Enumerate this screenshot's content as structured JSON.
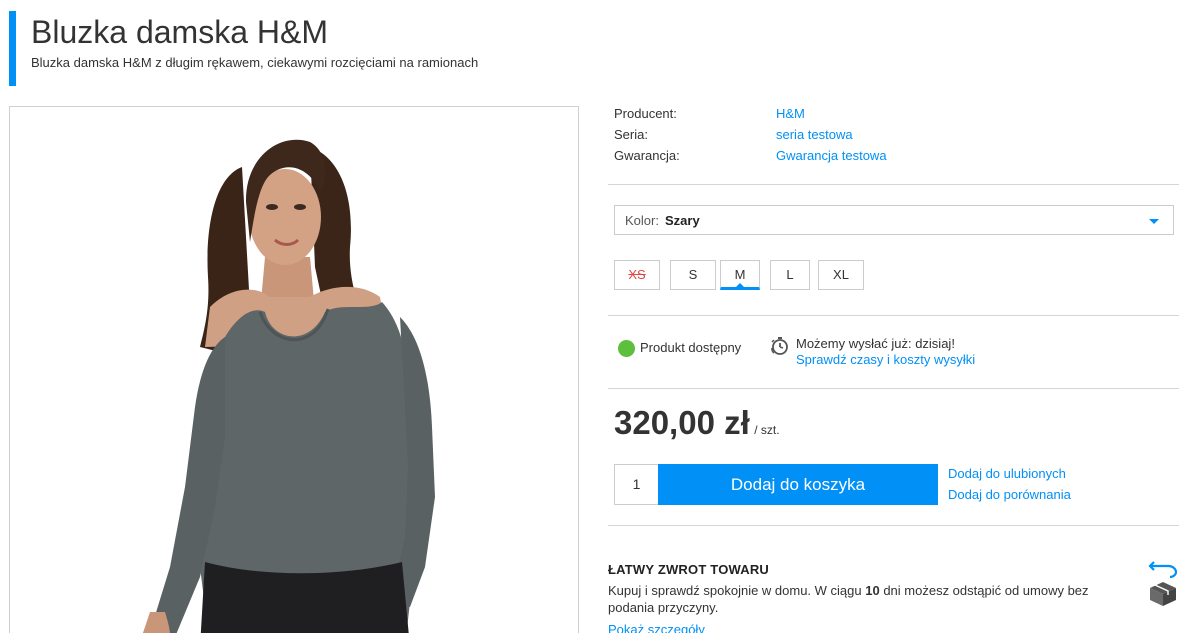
{
  "product": {
    "title": "Bluzka damska H&M",
    "subtitle": "Bluzka damska H&M z długim rękawem, ciekawymi rozcięciami na ramionach"
  },
  "image": {
    "alt": "model wearing grey blouse"
  },
  "specs": [
    {
      "key": "Producent:",
      "value": "H&M"
    },
    {
      "key": "Seria:",
      "value": "seria testowa"
    },
    {
      "key": "Gwarancja:",
      "value": "Gwarancja testowa"
    }
  ],
  "color": {
    "label": "Kolor:",
    "value": "Szary"
  },
  "sizes": [
    {
      "label": "XS",
      "state": "unavailable"
    },
    {
      "label": "S",
      "state": "available"
    },
    {
      "label": "M",
      "state": "selected"
    },
    {
      "label": "L",
      "state": "available"
    },
    {
      "label": "XL",
      "state": "available"
    }
  ],
  "availability": {
    "text": "Produkt dostępny",
    "shipping_line": "Możemy wysłać już:  dzisiaj!",
    "shipping_link": "Sprawdź czasy i koszty wysyłki"
  },
  "price": {
    "value": "320,00 zł",
    "unit": "/ szt."
  },
  "cart": {
    "quantity": "1",
    "add_label": "Dodaj do koszyka",
    "wishlist_label": "Dodaj do ulubionych",
    "compare_label": "Dodaj do porównania"
  },
  "returns": {
    "title": "ŁATWY ZWROT TOWARU",
    "text_before": "Kupuj i sprawdź spokojnie w domu. W ciągu ",
    "days": "10",
    "text_after": " dni możesz odstąpić od umowy bez podania przyczyny.",
    "link": "Pokaż szczegóły"
  },
  "colors": {
    "accent": "#0090f6",
    "available": "#5cc03c",
    "unavailable": "#e34646"
  }
}
